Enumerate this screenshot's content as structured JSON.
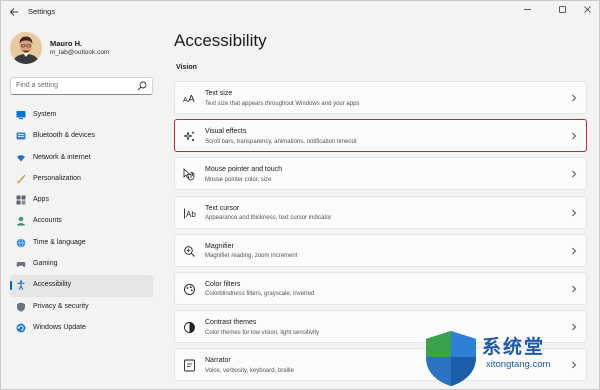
{
  "window": {
    "title": "Settings"
  },
  "profile": {
    "name": "Mauro H.",
    "email": "m_lab@outlook.com"
  },
  "search": {
    "placeholder": "Find a setting"
  },
  "sidebar": {
    "items": [
      {
        "label": "System",
        "icon": "monitor-icon"
      },
      {
        "label": "Bluetooth & devices",
        "icon": "bluetooth-icon"
      },
      {
        "label": "Network & internet",
        "icon": "wifi-icon"
      },
      {
        "label": "Personalization",
        "icon": "brush-icon"
      },
      {
        "label": "Apps",
        "icon": "apps-icon"
      },
      {
        "label": "Accounts",
        "icon": "person-icon"
      },
      {
        "label": "Time & language",
        "icon": "globe-icon"
      },
      {
        "label": "Gaming",
        "icon": "gamepad-icon"
      },
      {
        "label": "Accessibility",
        "icon": "accessibility-icon",
        "selected": true
      },
      {
        "label": "Privacy & security",
        "icon": "shield-icon"
      },
      {
        "label": "Windows Update",
        "icon": "update-icon"
      }
    ]
  },
  "main": {
    "title": "Accessibility",
    "section": "Vision",
    "settings": [
      {
        "title": "Text size",
        "desc": "Text size that appears throughout Windows and your apps",
        "icon": "text-size-icon"
      },
      {
        "title": "Visual effects",
        "desc": "Scroll bars, transparency, animations, notification timeout",
        "icon": "sparkle-icon",
        "highlighted": true
      },
      {
        "title": "Mouse pointer and touch",
        "desc": "Mouse pointer color, size",
        "icon": "pointer-icon"
      },
      {
        "title": "Text cursor",
        "desc": "Appearance and thickness, text cursor indicator",
        "icon": "text-cursor-icon"
      },
      {
        "title": "Magnifier",
        "desc": "Magnifier reading, zoom increment",
        "icon": "magnifier-icon"
      },
      {
        "title": "Color filters",
        "desc": "Colorblindness filters, grayscale, inverted",
        "icon": "color-filter-icon"
      },
      {
        "title": "Contrast themes",
        "desc": "Color themes for low vision, light sensitivity",
        "icon": "contrast-icon"
      },
      {
        "title": "Narrator",
        "desc": "Voice, verbosity, keyboard, braille",
        "icon": "narrator-icon"
      }
    ]
  },
  "watermark": {
    "text": "系统堂",
    "url": "xitongtang.com"
  },
  "colors": {
    "accent": "#0067c0",
    "highlight_border": "#c8262e",
    "background": "#f3f3f3",
    "card": "#fbfbfb"
  }
}
